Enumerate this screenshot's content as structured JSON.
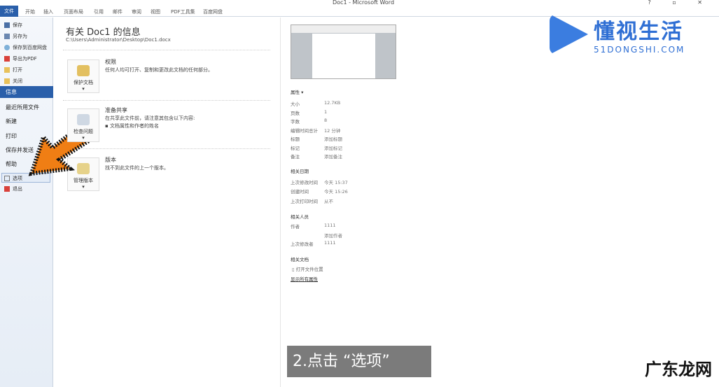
{
  "window": {
    "title": "Doc1 - Microsoft Word",
    "controls": "? ▫ ✕"
  },
  "ribbon": {
    "file": "文件",
    "tabs": [
      "开始",
      "插入",
      "页面布局",
      "引用",
      "邮件",
      "审阅",
      "视图",
      "PDF工具集",
      "百度网盘"
    ]
  },
  "sidebar": {
    "small_top": [
      "保存",
      "另存为",
      "保存到百度网盘",
      "导出为PDF",
      "打开",
      "关闭"
    ],
    "info": "信息",
    "big": [
      "最近所用文件",
      "新建",
      "打印",
      "保存并发送",
      "帮助"
    ],
    "options": "选项",
    "exit": "退出"
  },
  "main": {
    "title": "有关 Doc1 的信息",
    "path": "C:\\Users\\Administrator\\Desktop\\Doc1.docx",
    "sections": [
      {
        "button": "保护文档",
        "title": "权限",
        "desc": "任何人均可打开、复制和更改此文档的任何部分。"
      },
      {
        "button": "检查问题",
        "title": "准备共享",
        "desc": "在共享此文件前，请注意其包含以下内容:",
        "bullet": "文档属性和作者的姓名"
      },
      {
        "button": "管理版本",
        "title": "版本",
        "desc": "找不到此文件的上一个版本。"
      }
    ]
  },
  "props": {
    "header": "属性 ▾",
    "items": [
      [
        "大小",
        "12.7KB"
      ],
      [
        "页数",
        "1"
      ],
      [
        "字数",
        "8"
      ],
      [
        "编辑时间总计",
        "12 分钟"
      ],
      [
        "标题",
        "添加标题"
      ],
      [
        "标记",
        "添加标记"
      ],
      [
        "备注",
        "添加备注"
      ]
    ],
    "dates_header": "相关日期",
    "dates": [
      [
        "上次修改时间",
        "今天 15:37"
      ],
      [
        "创建时间",
        "今天 15:26"
      ],
      [
        "上次打印时间",
        "从不"
      ]
    ],
    "people_header": "相关人员",
    "people": [
      [
        "作者",
        "1111"
      ],
      [
        "",
        "添加作者"
      ],
      [
        "上次修改者",
        "1111"
      ]
    ],
    "docs_header": "相关文档",
    "open_location": "打开文件位置",
    "show_all": "显示所有属性"
  },
  "overlay": {
    "watermark_name": "懂视生活",
    "watermark_url": "51DONGSHI.COM",
    "caption": "2.点击 “选项”",
    "corner": "广东龙网"
  }
}
